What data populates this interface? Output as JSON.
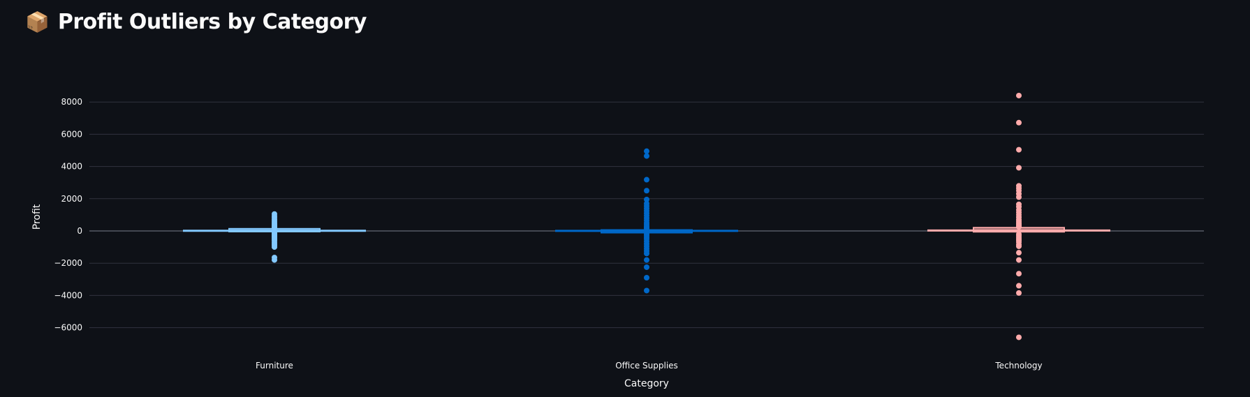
{
  "header": {
    "icon": "package-icon",
    "icon_glyph": "📦",
    "title": "Profit Outliers by Category"
  },
  "chart_data": {
    "type": "box",
    "xlabel": "Category",
    "ylabel": "Profit",
    "ylim": [
      -6700,
      8700
    ],
    "yticks": [
      8000,
      6000,
      4000,
      2000,
      0,
      -2000,
      -4000,
      -6000
    ],
    "ytick_labels": [
      "8000",
      "6000",
      "4000",
      "2000",
      "0",
      "−2000",
      "−4000",
      "−6000"
    ],
    "grid": true,
    "legend": "none",
    "categories": [
      "Furniture",
      "Office Supplies",
      "Technology"
    ],
    "series": [
      {
        "category": "Furniture",
        "color": "#83c9ff",
        "q1": 0,
        "median": 9,
        "q3": 95,
        "whisker_low": -25,
        "whisker_high": 35,
        "outliers": [
          1050,
          920,
          820,
          700,
          600,
          500,
          420,
          350,
          300,
          260,
          220,
          180,
          -120,
          -160,
          -200,
          -260,
          -320,
          -380,
          -450,
          -520,
          -600,
          -700,
          -800,
          -900,
          -1000,
          -1650,
          -1800
        ]
      },
      {
        "category": "Office Supplies",
        "color": "#0068c9",
        "q1": 2,
        "median": 7,
        "q3": 20,
        "whisker_low": -10,
        "whisker_high": 40,
        "outliers": [
          4950,
          4650,
          3180,
          2500,
          1950,
          1700,
          1550,
          1400,
          1250,
          1100,
          950,
          800,
          650,
          500,
          400,
          300,
          200,
          150,
          -120,
          -200,
          -300,
          -400,
          -500,
          -650,
          -800,
          -950,
          -1100,
          -1250,
          -1400,
          -1800,
          -2250,
          -2900,
          -3700
        ]
      },
      {
        "category": "Technology",
        "color": "#ffabab",
        "q1": -10,
        "median": 25,
        "q3": 160,
        "whisker_low": 20,
        "whisker_high": 90,
        "outliers": [
          8400,
          6720,
          5040,
          3920,
          2800,
          2650,
          2500,
          2300,
          2100,
          1650,
          1500,
          1300,
          1150,
          1000,
          850,
          700,
          600,
          500,
          420,
          350,
          300,
          250,
          -200,
          -300,
          -400,
          -500,
          -600,
          -700,
          -850,
          -950,
          -1350,
          -1800,
          -2650,
          -3400,
          -3850,
          -6600
        ]
      }
    ]
  }
}
